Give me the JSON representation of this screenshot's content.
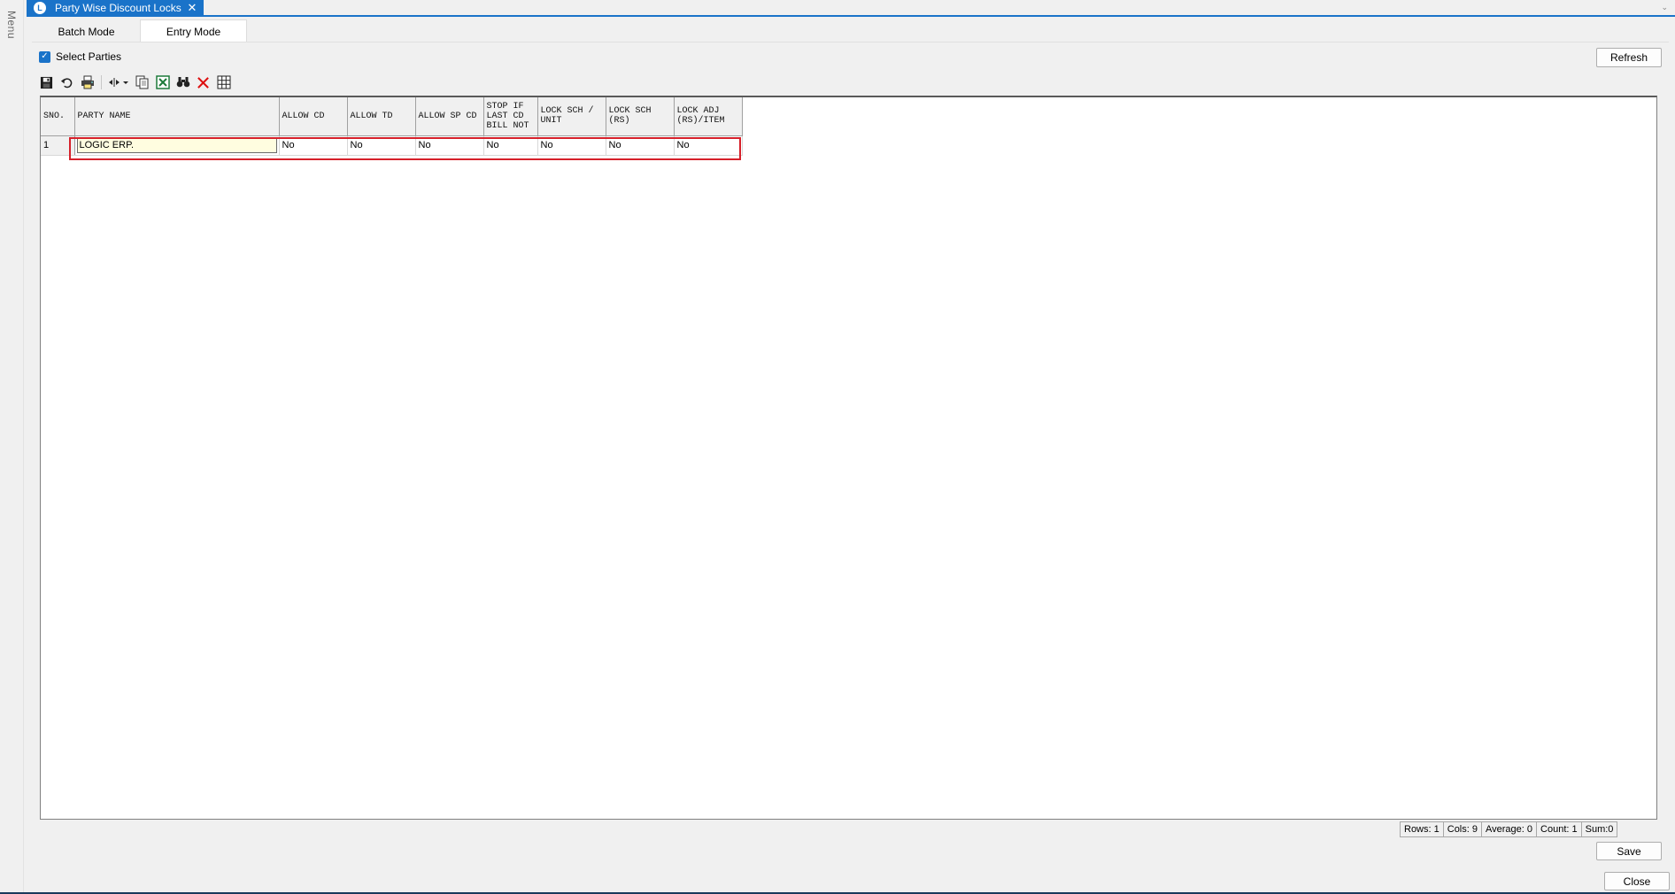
{
  "window": {
    "menu_label": "Menu",
    "doc_tab_title": "Party Wise Discount Locks",
    "app_icon_letter": "L"
  },
  "mode_tabs": [
    {
      "label": "Batch Mode",
      "active": false
    },
    {
      "label": "Entry Mode",
      "active": true
    }
  ],
  "select_parties": {
    "label": "Select Parties",
    "checked": true
  },
  "buttons": {
    "refresh": "Refresh",
    "save": "Save",
    "close": "Close"
  },
  "toolbar": [
    "save-icon",
    "undo-icon",
    "print-icon",
    "column-width-icon",
    "copy-icon",
    "excel-export-icon",
    "find-icon",
    "delete-icon",
    "grid-icon"
  ],
  "grid": {
    "headers": [
      "SNO.",
      "PARTY NAME",
      "ALLOW CD",
      "ALLOW TD",
      "ALLOW SP CD",
      "STOP IF LAST CD BILL NOT",
      "LOCK SCH / UNIT",
      "LOCK SCH (RS)",
      "LOCK ADJ (RS)/ITEM"
    ],
    "rows": [
      [
        "1",
        "LOGIC ERP.",
        "No",
        "No",
        "No",
        "No",
        "No",
        "No",
        "No"
      ]
    ]
  },
  "status": {
    "rows": "Rows: 1",
    "cols": "Cols: 9",
    "average": "Average: 0",
    "count": "Count: 1",
    "sum": "Sum:0"
  },
  "colors": {
    "accent": "#1a73c9",
    "highlight": "#d6202a",
    "edit_cell": "#fffde0"
  }
}
